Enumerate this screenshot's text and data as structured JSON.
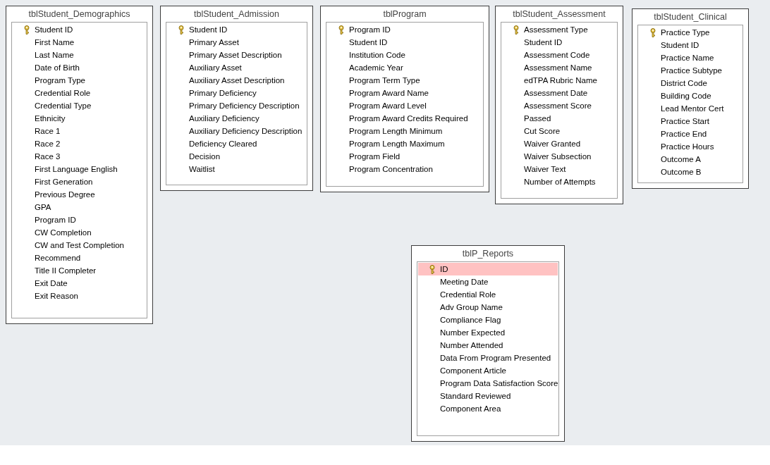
{
  "tables": [
    {
      "title": "tblStudent_Demographics",
      "fields": [
        {
          "name": "Student ID",
          "key": true,
          "selected": false
        },
        {
          "name": "First Name",
          "key": false,
          "selected": false
        },
        {
          "name": "Last Name",
          "key": false,
          "selected": false
        },
        {
          "name": "Date of Birth",
          "key": false,
          "selected": false
        },
        {
          "name": "Program Type",
          "key": false,
          "selected": false
        },
        {
          "name": "Credential Role",
          "key": false,
          "selected": false
        },
        {
          "name": "Credential Type",
          "key": false,
          "selected": false
        },
        {
          "name": "Ethnicity",
          "key": false,
          "selected": false
        },
        {
          "name": "Race 1",
          "key": false,
          "selected": false
        },
        {
          "name": "Race 2",
          "key": false,
          "selected": false
        },
        {
          "name": "Race 3",
          "key": false,
          "selected": false
        },
        {
          "name": "First Language English",
          "key": false,
          "selected": false
        },
        {
          "name": "First Generation",
          "key": false,
          "selected": false
        },
        {
          "name": "Previous Degree",
          "key": false,
          "selected": false
        },
        {
          "name": "GPA",
          "key": false,
          "selected": false
        },
        {
          "name": "Program ID",
          "key": false,
          "selected": false
        },
        {
          "name": "CW Completion",
          "key": false,
          "selected": false
        },
        {
          "name": "CW and Test Completion",
          "key": false,
          "selected": false
        },
        {
          "name": "Recommend",
          "key": false,
          "selected": false
        },
        {
          "name": "Title II Completer",
          "key": false,
          "selected": false
        },
        {
          "name": "Exit Date",
          "key": false,
          "selected": false
        },
        {
          "name": "Exit Reason",
          "key": false,
          "selected": false
        }
      ]
    },
    {
      "title": "tblStudent_Admission",
      "fields": [
        {
          "name": "Student ID",
          "key": true,
          "selected": false
        },
        {
          "name": "Primary Asset",
          "key": false,
          "selected": false
        },
        {
          "name": "Primary Asset Description",
          "key": false,
          "selected": false
        },
        {
          "name": "Auxiliary Asset",
          "key": false,
          "selected": false
        },
        {
          "name": "Auxiliary Asset Description",
          "key": false,
          "selected": false
        },
        {
          "name": "Primary Deficiency",
          "key": false,
          "selected": false
        },
        {
          "name": "Primary Deficiency Description",
          "key": false,
          "selected": false
        },
        {
          "name": "Auxiliary Deficiency",
          "key": false,
          "selected": false
        },
        {
          "name": "Auxiliary Deficiency Description",
          "key": false,
          "selected": false
        },
        {
          "name": "Deficiency Cleared",
          "key": false,
          "selected": false
        },
        {
          "name": "Decision",
          "key": false,
          "selected": false
        },
        {
          "name": "Waitlist",
          "key": false,
          "selected": false
        }
      ]
    },
    {
      "title": "tblProgram",
      "fields": [
        {
          "name": "Program ID",
          "key": true,
          "selected": false
        },
        {
          "name": "Student ID",
          "key": false,
          "selected": false
        },
        {
          "name": "Institution Code",
          "key": false,
          "selected": false
        },
        {
          "name": "Academic Year",
          "key": false,
          "selected": false
        },
        {
          "name": "Program Term Type",
          "key": false,
          "selected": false
        },
        {
          "name": "Program Award Name",
          "key": false,
          "selected": false
        },
        {
          "name": "Program Award Level",
          "key": false,
          "selected": false
        },
        {
          "name": "Program Award Credits Required",
          "key": false,
          "selected": false
        },
        {
          "name": "Program Length Minimum",
          "key": false,
          "selected": false
        },
        {
          "name": "Program Length Maximum",
          "key": false,
          "selected": false
        },
        {
          "name": "Program Field",
          "key": false,
          "selected": false
        },
        {
          "name": "Program Concentration",
          "key": false,
          "selected": false
        }
      ]
    },
    {
      "title": "tblStudent_Assessment",
      "fields": [
        {
          "name": "Assessment Type",
          "key": true,
          "selected": false
        },
        {
          "name": "Student ID",
          "key": false,
          "selected": false
        },
        {
          "name": "Assessment Code",
          "key": false,
          "selected": false
        },
        {
          "name": "Assessment Name",
          "key": false,
          "selected": false
        },
        {
          "name": "edTPA Rubric Name",
          "key": false,
          "selected": false
        },
        {
          "name": "Assessment Date",
          "key": false,
          "selected": false
        },
        {
          "name": "Assessment Score",
          "key": false,
          "selected": false
        },
        {
          "name": "Passed",
          "key": false,
          "selected": false
        },
        {
          "name": "Cut Score",
          "key": false,
          "selected": false
        },
        {
          "name": "Waiver Granted",
          "key": false,
          "selected": false
        },
        {
          "name": "Waiver Subsection",
          "key": false,
          "selected": false
        },
        {
          "name": "Waiver Text",
          "key": false,
          "selected": false
        },
        {
          "name": "Number of Attempts",
          "key": false,
          "selected": false
        }
      ]
    },
    {
      "title": "tblStudent_Clinical",
      "fields": [
        {
          "name": "Practice Type",
          "key": true,
          "selected": false
        },
        {
          "name": "Student ID",
          "key": false,
          "selected": false
        },
        {
          "name": "Practice Name",
          "key": false,
          "selected": false
        },
        {
          "name": "Practice Subtype",
          "key": false,
          "selected": false
        },
        {
          "name": "District Code",
          "key": false,
          "selected": false
        },
        {
          "name": "Building Code",
          "key": false,
          "selected": false
        },
        {
          "name": "Lead Mentor Cert",
          "key": false,
          "selected": false
        },
        {
          "name": "Practice Start",
          "key": false,
          "selected": false
        },
        {
          "name": "Practice End",
          "key": false,
          "selected": false
        },
        {
          "name": "Practice Hours",
          "key": false,
          "selected": false
        },
        {
          "name": "Outcome A",
          "key": false,
          "selected": false
        },
        {
          "name": "Outcome B",
          "key": false,
          "selected": false
        }
      ]
    },
    {
      "title": "tblP_Reports",
      "fields": [
        {
          "name": "ID",
          "key": true,
          "selected": true
        },
        {
          "name": "Meeting Date",
          "key": false,
          "selected": false
        },
        {
          "name": "Credential Role",
          "key": false,
          "selected": false
        },
        {
          "name": "Adv Group Name",
          "key": false,
          "selected": false
        },
        {
          "name": "Compliance Flag",
          "key": false,
          "selected": false
        },
        {
          "name": "Number Expected",
          "key": false,
          "selected": false
        },
        {
          "name": "Number Attended",
          "key": false,
          "selected": false
        },
        {
          "name": "Data From Program Presented",
          "key": false,
          "selected": false
        },
        {
          "name": "Component Article",
          "key": false,
          "selected": false
        },
        {
          "name": "Program Data Satisfaction Score",
          "key": false,
          "selected": false
        },
        {
          "name": "Standard Reviewed",
          "key": false,
          "selected": false
        },
        {
          "name": "Component Area",
          "key": false,
          "selected": false
        }
      ]
    }
  ]
}
